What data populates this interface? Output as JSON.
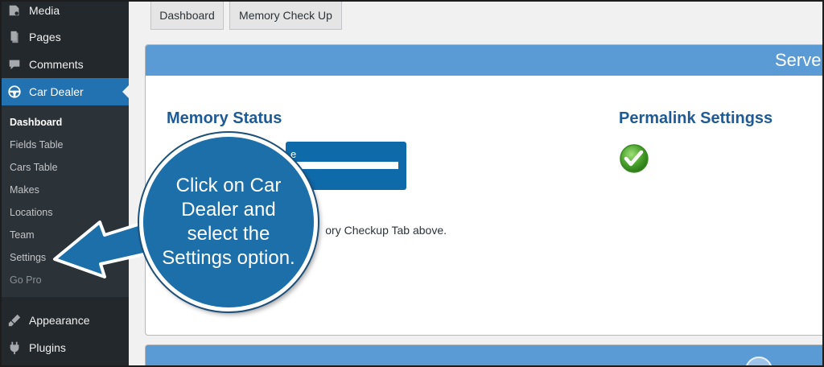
{
  "sidebar": {
    "menu": [
      {
        "label": "Media",
        "icon": "media-icon"
      },
      {
        "label": "Pages",
        "icon": "pages-icon"
      },
      {
        "label": "Comments",
        "icon": "comments-icon"
      },
      {
        "label": "Car Dealer",
        "icon": "steering-wheel-icon",
        "active": true
      },
      {
        "label": "Appearance",
        "icon": "appearance-icon"
      },
      {
        "label": "Plugins",
        "icon": "plugins-icon"
      }
    ],
    "submenu": [
      {
        "label": "Dashboard",
        "current": true
      },
      {
        "label": "Fields Table"
      },
      {
        "label": "Cars Table"
      },
      {
        "label": "Makes"
      },
      {
        "label": "Locations"
      },
      {
        "label": "Team"
      },
      {
        "label": "Settings"
      },
      {
        "label": "Go Pro"
      }
    ]
  },
  "tabs": [
    {
      "label": "Dashboard"
    },
    {
      "label": "Memory Check Up"
    }
  ],
  "panel": {
    "title": "Serve",
    "memory_status": "Memory Status",
    "memory_label": "e",
    "permalink_settings": "Permalink Settingss",
    "note": "ory Checkup Tab above."
  },
  "callout": {
    "text": "Click on Car Dealer and select the Settings option."
  },
  "colors": {
    "sidebar_bg": "#23282d",
    "submenu_bg": "#2c3338",
    "active_menu": "#2271b1",
    "panel_header": "#5b9bd5",
    "callout": "#1c6fa9"
  }
}
